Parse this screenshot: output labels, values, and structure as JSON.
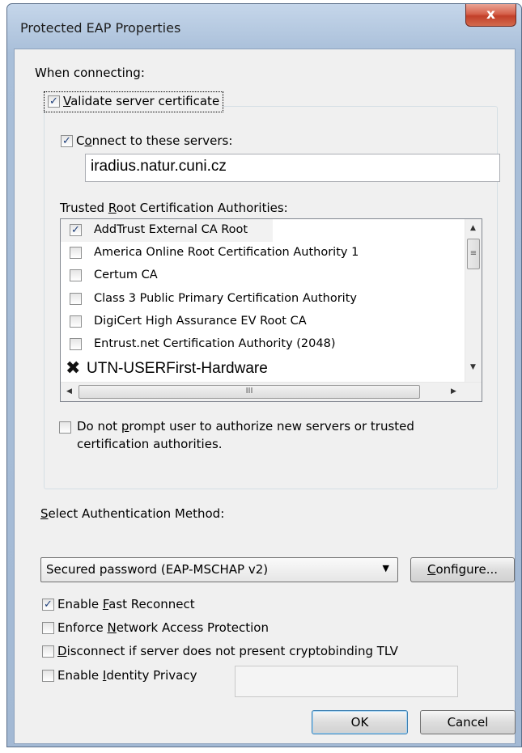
{
  "window": {
    "title": "Protected EAP Properties",
    "close_glyph": "x"
  },
  "when_connecting": "When connecting:",
  "validate_cert": {
    "pre": "",
    "key": "V",
    "post": "alidate server certificate",
    "checked": true
  },
  "connect_servers": {
    "pre": "C",
    "key": "o",
    "post": "nnect to these servers:",
    "checked": true,
    "value": "iradius.natur.cuni.cz"
  },
  "trusted_root": {
    "pre": "Trusted ",
    "key": "R",
    "post": "oot Certification Authorities:",
    "items": [
      {
        "label": "AddTrust External CA Root",
        "checked": true
      },
      {
        "label": "America Online Root Certification Authority 1",
        "checked": false
      },
      {
        "label": "Certum CA",
        "checked": false
      },
      {
        "label": "Class 3 Public Primary Certification Authority",
        "checked": false
      },
      {
        "label": "DigiCert High Assurance EV Root CA",
        "checked": false
      },
      {
        "label": "Entrust.net Certification Authority (2048)",
        "checked": false
      },
      {
        "label": "UTN-USERFirst-Hardware",
        "checked": true
      }
    ],
    "hscroll_thumb": "III"
  },
  "no_prompt": {
    "line1_pre": "Do not ",
    "line1_key": "p",
    "line1_post": "rompt user to authorize new servers or trusted",
    "line2": "certification authorities.",
    "checked": false
  },
  "auth_method": {
    "pre": "",
    "key": "S",
    "post": "elect Authentication Method:",
    "selected": "Secured password (EAP-MSCHAP v2)",
    "configure_pre": "",
    "configure_key": "C",
    "configure_post": "onfigure..."
  },
  "options": [
    {
      "pre": "Enable ",
      "key": "F",
      "post": "ast Reconnect",
      "checked": true
    },
    {
      "pre": "Enforce ",
      "key": "N",
      "post": "etwork Access Protection",
      "checked": false
    },
    {
      "pre": "",
      "key": "D",
      "post": "isconnect if server does not present cryptobinding TLV",
      "checked": false
    },
    {
      "pre": "Enable ",
      "key": "I",
      "post": "dentity Privacy",
      "checked": false
    }
  ],
  "identity_privacy_value": "",
  "buttons": {
    "ok": "OK",
    "cancel": "Cancel"
  },
  "check_glyph": "✓",
  "cross_glyph": "✖"
}
